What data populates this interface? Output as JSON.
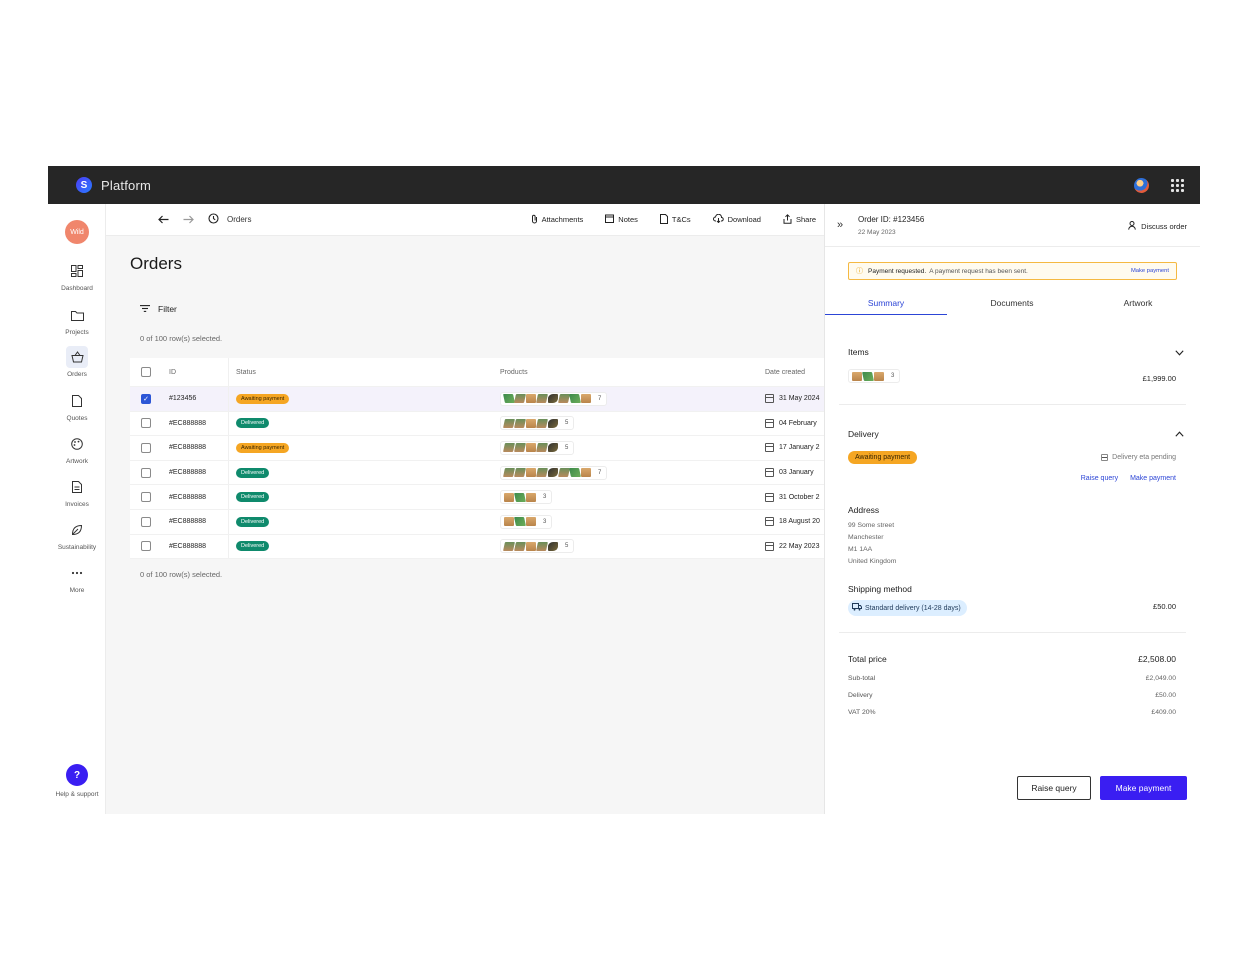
{
  "app": {
    "brand": "Platform",
    "org_initials": "Wild"
  },
  "nav": {
    "items": [
      {
        "label": "Dashboard"
      },
      {
        "label": "Projects"
      },
      {
        "label": "Orders"
      },
      {
        "label": "Quotes"
      },
      {
        "label": "Artwork"
      },
      {
        "label": "Invoices"
      },
      {
        "label": "Sustainability"
      },
      {
        "label": "More"
      }
    ],
    "help_label": "Help & support",
    "help_glyph": "?"
  },
  "toolbar": {
    "crumb": "Orders",
    "actions": [
      {
        "label": "Attachments",
        "icon": "paperclip-icon"
      },
      {
        "label": "Notes",
        "icon": "note-icon"
      },
      {
        "label": "T&Cs",
        "icon": "document-icon"
      },
      {
        "label": "Download",
        "icon": "cloud-download-icon"
      },
      {
        "label": "Share",
        "icon": "share-icon"
      }
    ]
  },
  "page": {
    "title": "Orders",
    "filter_label": "Filter",
    "selection_top": "0 of 100 row(s) selected.",
    "selection_bottom": "0 of 100 row(s) selected."
  },
  "table": {
    "headers": {
      "id": "ID",
      "status": "Status",
      "products": "Products",
      "date": "Date created"
    },
    "rows": [
      {
        "id": "#123456",
        "status": "Awaiting payment",
        "status_kind": "await",
        "products": [
          "note",
          "tin",
          "box",
          "tin",
          "bag",
          "tin",
          "note",
          "box"
        ],
        "count": "7",
        "date": "31 May 2024",
        "selected": true
      },
      {
        "id": "#EC888888",
        "status": "Delivered",
        "status_kind": "deliv",
        "products": [
          "tin",
          "tin",
          "box",
          "tin",
          "bag"
        ],
        "count": "5",
        "date": "04 February",
        "selected": false
      },
      {
        "id": "#EC888888",
        "status": "Awaiting payment",
        "status_kind": "await",
        "products": [
          "tin",
          "tin",
          "box",
          "tin",
          "bag"
        ],
        "count": "5",
        "date": "17 January 2",
        "selected": false
      },
      {
        "id": "#EC888888",
        "status": "Delivered",
        "status_kind": "deliv",
        "products": [
          "tin",
          "tin",
          "box",
          "tin",
          "bag",
          "tin",
          "note",
          "box"
        ],
        "count": "7",
        "date": "03 January",
        "selected": false
      },
      {
        "id": "#EC888888",
        "status": "Delivered",
        "status_kind": "deliv",
        "products": [
          "box",
          "note",
          "box"
        ],
        "count": "3",
        "date": "31 October 2",
        "selected": false
      },
      {
        "id": "#EC888888",
        "status": "Delivered",
        "status_kind": "deliv",
        "products": [
          "box",
          "note",
          "box"
        ],
        "count": "3",
        "date": "18 August 20",
        "selected": false
      },
      {
        "id": "#EC888888",
        "status": "Delivered",
        "status_kind": "deliv",
        "products": [
          "tin",
          "tin",
          "box",
          "tin",
          "bag"
        ],
        "count": "5",
        "date": "22 May 2023",
        "selected": false
      }
    ]
  },
  "panel": {
    "order_id": "Order ID: #123456",
    "order_date": "22 May 2023",
    "discuss": "Discuss order",
    "alert": {
      "strong": "Payment requested.",
      "text": "A payment request has been sent.",
      "link": "Make payment"
    },
    "tabs": [
      "Summary",
      "Documents",
      "Artwork"
    ],
    "items": {
      "title": "Items",
      "count": "3",
      "total": "£1,999.00"
    },
    "delivery": {
      "title": "Delivery",
      "status": "Awaiting payment",
      "eta": "Delivery eta pending",
      "link_query": "Raise query",
      "link_pay": "Make payment"
    },
    "address": {
      "title": "Address",
      "lines": [
        "99 Some street",
        "Manchester",
        "M1 1AA",
        "United Kingdom"
      ]
    },
    "shipping": {
      "title": "Shipping method",
      "method": "Standard delivery (14-28 days)",
      "price": "£50.00"
    },
    "totals": {
      "title": "Total price",
      "total": "£2,508.00",
      "rows": [
        {
          "label": "Sub-total",
          "value": "£2,049.00"
        },
        {
          "label": "Delivery",
          "value": "£50.00"
        },
        {
          "label": "VAT 20%",
          "value": "£409.00"
        }
      ]
    },
    "buttons": {
      "raise_query": "Raise query",
      "make_payment": "Make payment"
    }
  }
}
